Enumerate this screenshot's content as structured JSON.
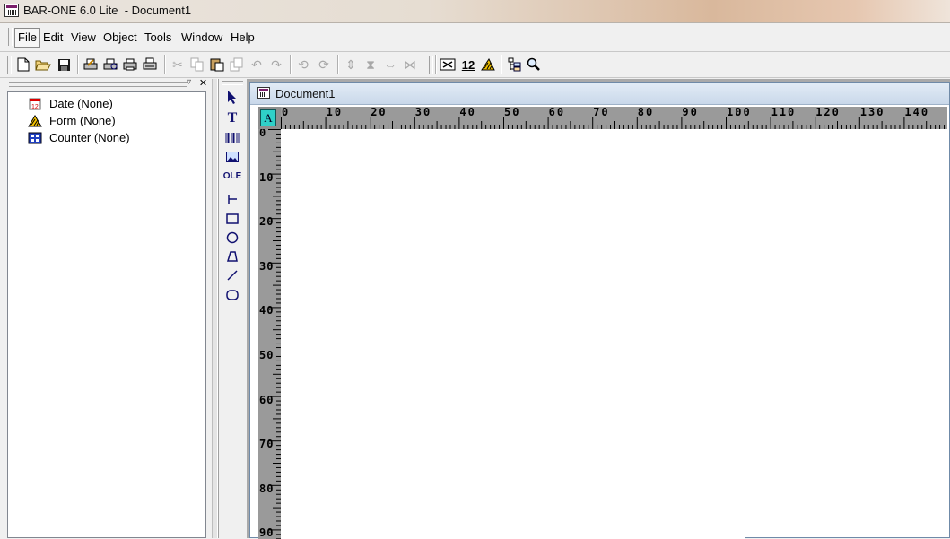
{
  "window": {
    "title": "BAR-ONE 6.0 Lite  - Document1"
  },
  "menu": {
    "items": [
      {
        "label": "File",
        "key": "F"
      },
      {
        "label": "Edit",
        "key": "E"
      },
      {
        "label": "View",
        "key": "V"
      },
      {
        "label": "Object",
        "key": "O"
      },
      {
        "label": "Tools",
        "key": "T"
      },
      {
        "label": "Window",
        "key": "W"
      },
      {
        "label": "Help",
        "key": "H"
      }
    ]
  },
  "toolbar": {
    "font_size_value": "12",
    "icons": [
      "new-icon",
      "open-icon",
      "save-icon",
      "print-setup-icon",
      "print-preview-icon",
      "print-icon",
      "print-all-icon",
      "cut-icon",
      "copy-icon",
      "paste-icon",
      "duplicate-icon",
      "undo-icon",
      "redo-icon",
      "rotate-left-icon",
      "rotate-right-icon",
      "flip-vertical-icon",
      "center-vertical-icon",
      "flip-horizontal-icon",
      "center-horizontal-icon",
      "barcode-properties-icon",
      "font-size-icon",
      "form-icon",
      "tree-view-icon",
      "zoom-icon"
    ]
  },
  "tree": {
    "nodes": [
      {
        "label": "Date (None)",
        "icon": "calendar-icon"
      },
      {
        "label": "Form (None)",
        "icon": "form-icon"
      },
      {
        "label": "Counter (None)",
        "icon": "counter-icon"
      }
    ]
  },
  "palette": {
    "tools": [
      "select-arrow-icon",
      "text-tool-icon",
      "barcode-tool-icon",
      "image-tool-icon",
      "ole-tool-icon",
      "line-tool-icon",
      "rectangle-tool-icon",
      "ellipse-tool-icon",
      "polygon-tool-icon",
      "diagonal-line-tool-icon",
      "rounded-rectangle-tool-icon"
    ],
    "ole_label": "OLE"
  },
  "document": {
    "title": "Document1",
    "corner_label": "A",
    "hruler_labels": [
      "0",
      "10",
      "20",
      "30",
      "40",
      "50",
      "60",
      "70",
      "80",
      "90",
      "100",
      "110",
      "120",
      "130",
      "140"
    ],
    "vruler_labels": [
      "0",
      "10",
      "20",
      "30",
      "40",
      "50",
      "60",
      "70",
      "80",
      "90"
    ]
  },
  "colors": {
    "ruler": "#9a9a9a",
    "mdi_background": "#a9a9a9",
    "doc_title": "#c9d8ea"
  }
}
